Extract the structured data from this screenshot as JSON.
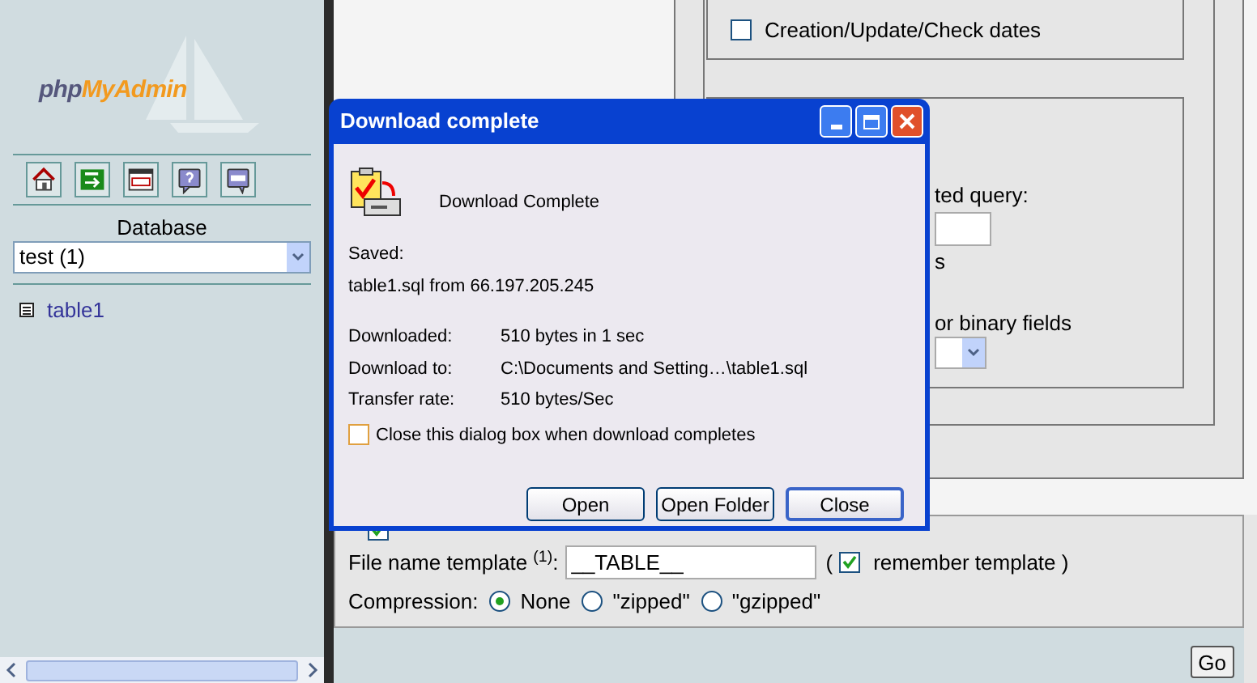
{
  "sidebar": {
    "logo": {
      "prefix": "php",
      "name": "MyAdmin"
    },
    "toolbar": [
      {
        "kind": "home"
      },
      {
        "kind": "exit"
      },
      {
        "kind": "sql"
      },
      {
        "kind": "help"
      },
      {
        "kind": "docs"
      }
    ],
    "database_label": "Database",
    "database_select": "test (1)",
    "tables": [
      {
        "label": "table1"
      }
    ]
  },
  "main": {
    "comments_option": {
      "label": "Creation/Update/Check dates",
      "checked": false
    },
    "partial_texts": [
      "ted query:",
      "s",
      "or binary fields"
    ],
    "save_as_file": {
      "checked": true
    },
    "file_name_label": "File name template $^{(1)}$:",
    "file_name_value": "__TABLE__",
    "paren_open": "(",
    "remember": {
      "label": "remember template )",
      "checked": true
    },
    "compression_label": "Compression:",
    "compression": [
      {
        "label": "None",
        "selected": true
      },
      {
        "label": "\"zipped\"",
        "selected": false
      },
      {
        "label": "\"gzipped\"",
        "selected": false
      }
    ],
    "go": "Go"
  },
  "dialog": {
    "title": "Download complete",
    "heading": "Download Complete",
    "saved_label": "Saved:",
    "saved_value": "table1.sql from 66.197.205.245",
    "details": [
      {
        "label": "Downloaded:",
        "value": "510 bytes in 1 sec"
      },
      {
        "label": "Download to:",
        "value": "C:\\Documents and Setting…\\table1.sql"
      },
      {
        "label": "Transfer rate:",
        "value": "510 bytes/Sec"
      }
    ],
    "close_when_done": {
      "label": "Close this dialog box when download completes",
      "checked": false
    },
    "buttons": [
      {
        "label": "Open",
        "selected": false
      },
      {
        "label": "Open Folder",
        "selected": false
      },
      {
        "label": "Close",
        "selected": true
      }
    ]
  }
}
